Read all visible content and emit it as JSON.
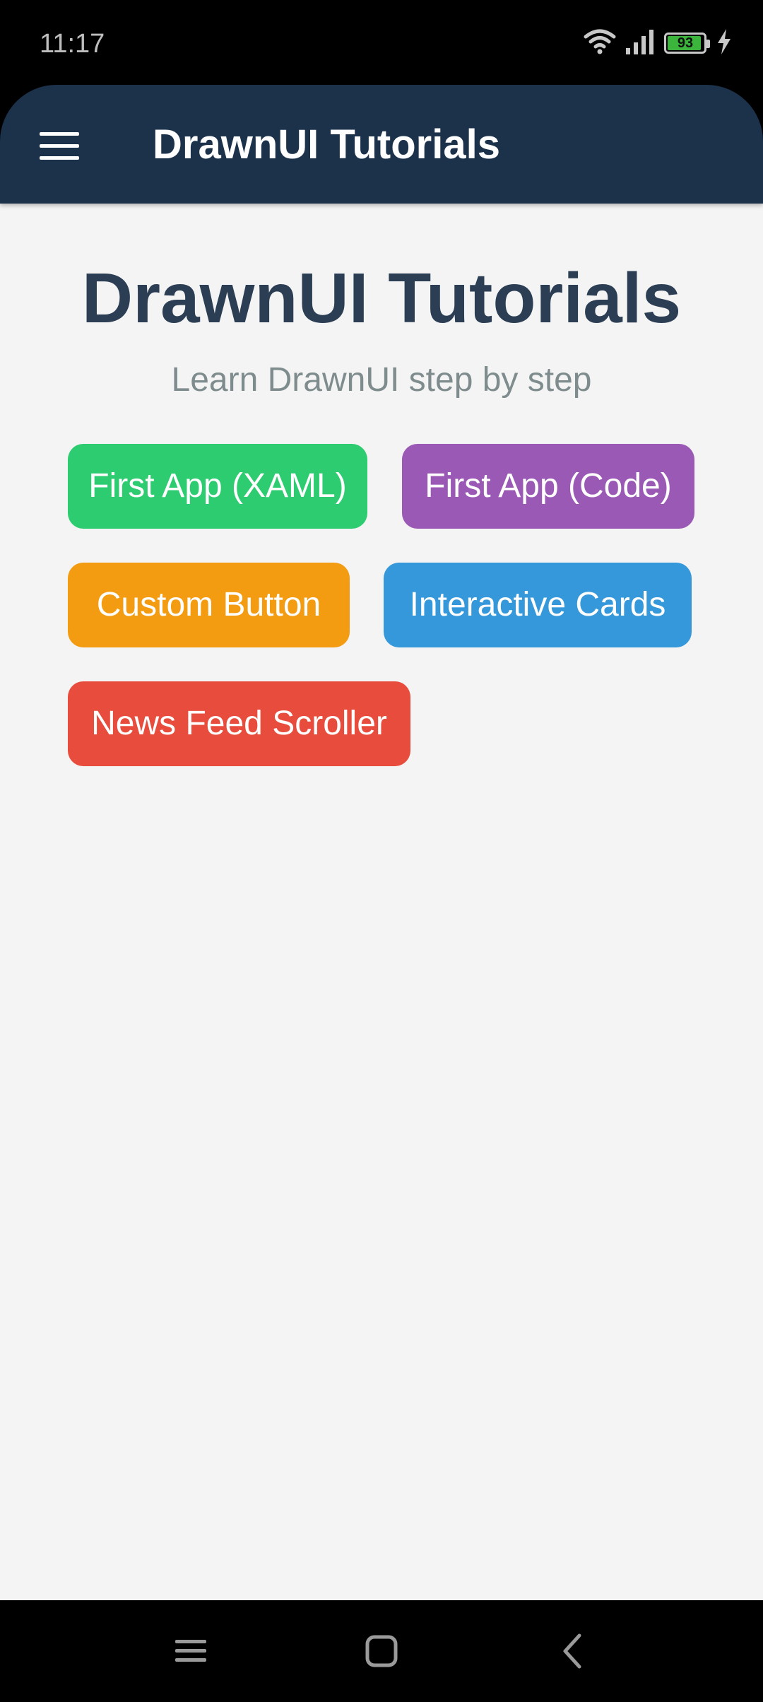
{
  "status_bar": {
    "time": "11:17",
    "battery_level": "93",
    "icons": [
      "wifi-icon",
      "signal-icon",
      "battery-icon",
      "charging-icon"
    ]
  },
  "app_bar": {
    "title": "DrawnUI Tutorials",
    "menu_icon": "hamburger-menu-icon",
    "background": "#1c324b"
  },
  "main": {
    "title": "DrawnUI Tutorials",
    "subtitle": "Learn DrawnUI step by step",
    "buttons": [
      {
        "label": "First App (XAML)",
        "color": "#2ecc71"
      },
      {
        "label": "First App (Code)",
        "color": "#9b59b6"
      },
      {
        "label": "Custom Button",
        "color": "#f39c12"
      },
      {
        "label": "Interactive Cards",
        "color": "#3498db"
      },
      {
        "label": "News Feed Scroller",
        "color": "#e74c3c"
      }
    ]
  },
  "nav_bar": {
    "icons": [
      "recents-icon",
      "home-icon",
      "back-icon"
    ]
  }
}
